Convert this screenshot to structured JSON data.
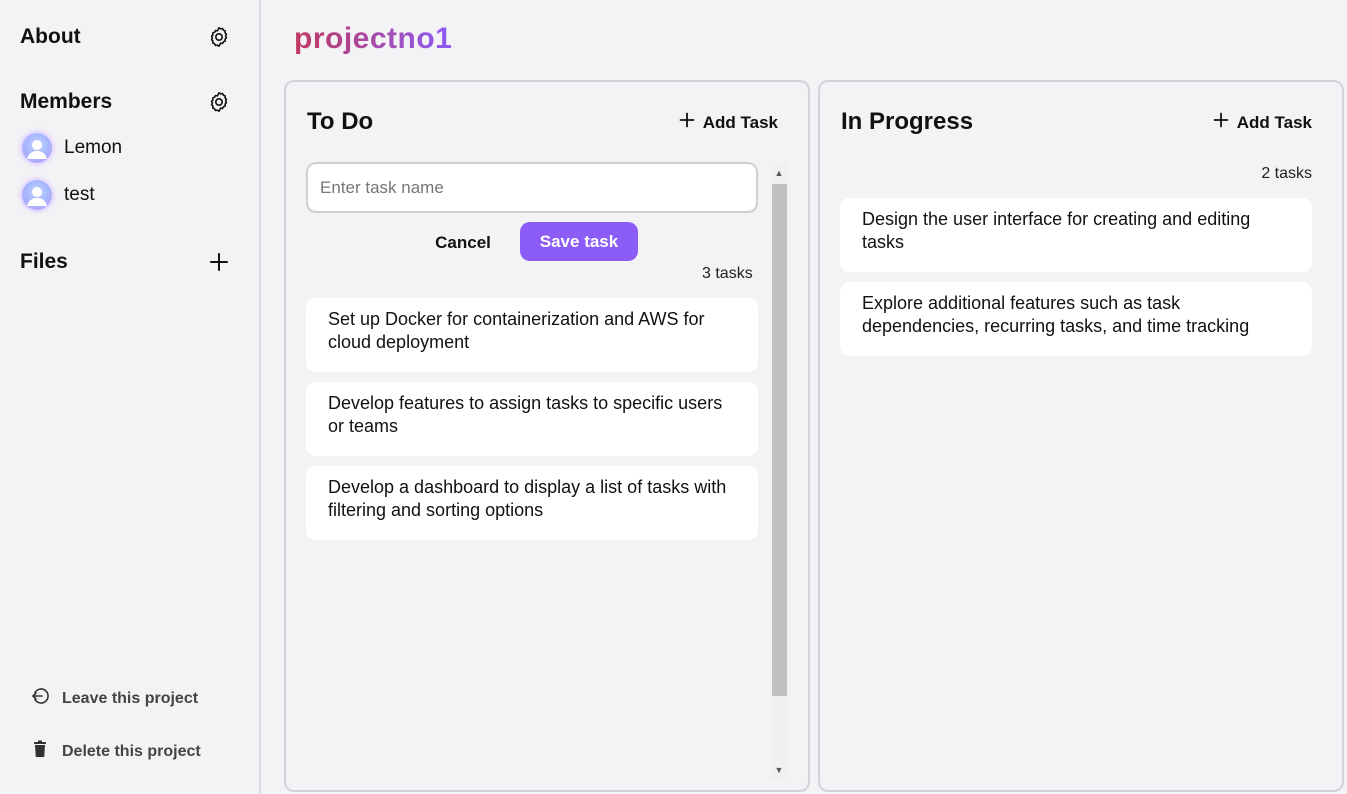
{
  "project": {
    "title": "projectno1"
  },
  "sidebar": {
    "about_label": "About",
    "members_label": "Members",
    "members": [
      {
        "name": "Lemon"
      },
      {
        "name": "test"
      }
    ],
    "files_label": "Files",
    "leave_label": "Leave this project",
    "delete_label": "Delete this project"
  },
  "columns": {
    "todo": {
      "title": "To Do",
      "add_label": "Add Task",
      "input_placeholder": "Enter task name",
      "cancel_label": "Cancel",
      "save_label": "Save task",
      "count_label": "3 tasks",
      "tasks": [
        "Set up Docker for containerization and AWS for cloud deployment",
        "Develop features to assign tasks to specific users or teams",
        "Develop a dashboard to display a list of tasks with filtering and sorting options"
      ]
    },
    "in_progress": {
      "title": "In Progress",
      "add_label": "Add Task",
      "count_label": "2 tasks",
      "tasks": [
        "Design the user interface for creating and editing tasks",
        "Explore additional features such as task dependencies, recurring tasks, and time tracking"
      ]
    }
  },
  "colors": {
    "accent": "#8b5cf6",
    "title_gradient_start": "#c0395e",
    "title_gradient_end": "#8b5cf6",
    "background": "#f3f3f6"
  },
  "icons": {
    "about_settings": "gear-icon",
    "members_settings": "gear-icon",
    "files_add": "plus-icon",
    "leave": "logout-icon",
    "delete": "trash-icon"
  }
}
